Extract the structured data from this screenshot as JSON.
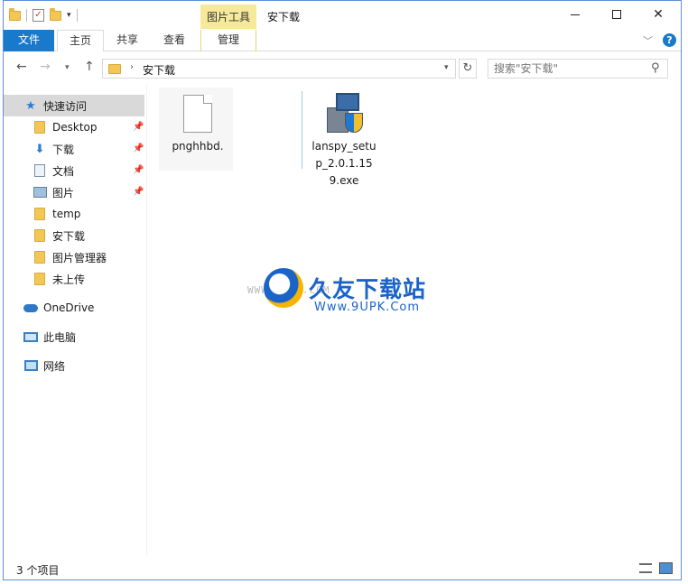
{
  "titlebar": {
    "contextual_tab_group": "图片工具",
    "window_title": "安下载",
    "minimize_icon": "minimize-icon",
    "maximize_icon": "maximize-icon",
    "close_icon": "close-icon"
  },
  "ribbon": {
    "tabs": [
      {
        "label": "文件"
      },
      {
        "label": "主页"
      },
      {
        "label": "共享"
      },
      {
        "label": "查看"
      },
      {
        "label": "管理"
      }
    ],
    "help_label": "?"
  },
  "address": {
    "crumb": "安下载",
    "search_placeholder": "搜索\"安下载\""
  },
  "sidebar": {
    "items": [
      {
        "label": "快速访问",
        "icon": "star-icon"
      },
      {
        "label": "Desktop",
        "icon": "folder-icon",
        "pinned": true
      },
      {
        "label": "下载",
        "icon": "download-icon",
        "pinned": true
      },
      {
        "label": "文档",
        "icon": "document-icon",
        "pinned": true
      },
      {
        "label": "图片",
        "icon": "picture-icon",
        "pinned": true
      },
      {
        "label": "temp",
        "icon": "folder-icon"
      },
      {
        "label": "安下载",
        "icon": "folder-icon"
      },
      {
        "label": "图片管理器",
        "icon": "folder-icon"
      },
      {
        "label": "未上传",
        "icon": "folder-icon"
      },
      {
        "label": "OneDrive",
        "icon": "cloud-icon"
      },
      {
        "label": "此电脑",
        "icon": "computer-icon"
      },
      {
        "label": "网络",
        "icon": "network-icon"
      }
    ]
  },
  "files": [
    {
      "name": "pnghhbd.",
      "icon": "blank-file-icon"
    },
    {
      "name": "lanspy_setup_2.0.1.159.exe",
      "icon": "installer-icon"
    }
  ],
  "watermark": {
    "small": "WWW.9UPK.COM",
    "big": "久友下载站",
    "url": "Www.9UPK.Com"
  },
  "status": {
    "item_count": "3 个项目"
  },
  "colors": {
    "accent": "#1979ca",
    "contextual_tab": "#f6e99a",
    "selected_row": "#d9d9d9"
  }
}
